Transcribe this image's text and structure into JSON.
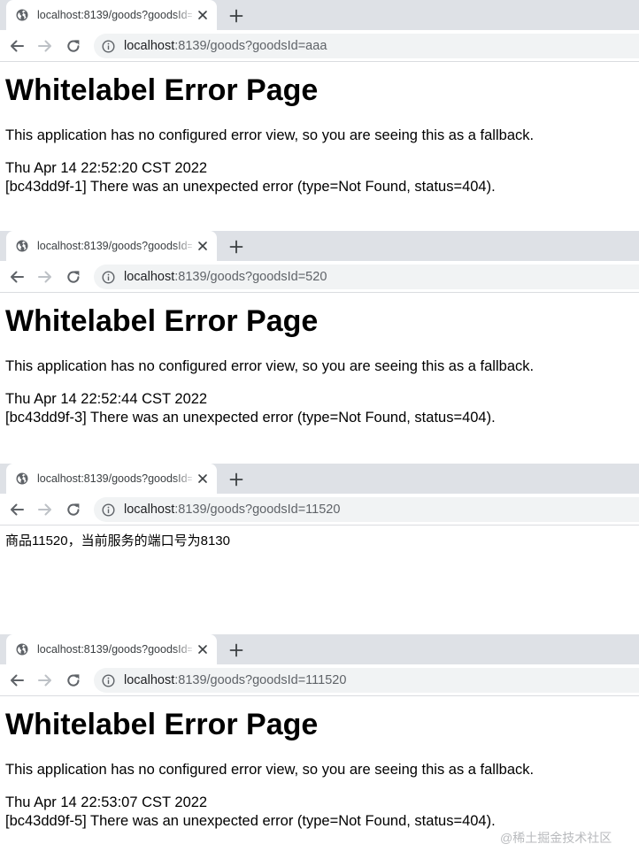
{
  "windows": [
    {
      "tab_title": "localhost:8139/goods?goodsId=aaa",
      "url_host": "localhost",
      "url_rest": ":8139/goods?goodsId=aaa",
      "heading": "Whitelabel Error Page",
      "message": "This application has no configured error view, so you are seeing this as a fallback.",
      "timestamp": "Thu Apr 14 22:52:20 CST 2022",
      "error_detail": "[bc43dd9f-1] There was an unexpected error (type=Not Found, status=404)."
    },
    {
      "tab_title": "localhost:8139/goods?goodsId=520",
      "url_host": "localhost",
      "url_rest": ":8139/goods?goodsId=520",
      "heading": "Whitelabel Error Page",
      "message": "This application has no configured error view, so you are seeing this as a fallback.",
      "timestamp": "Thu Apr 14 22:52:44 CST 2022",
      "error_detail": "[bc43dd9f-3] There was an unexpected error (type=Not Found, status=404)."
    },
    {
      "tab_title": "localhost:8139/goods?goodsId=11520",
      "url_host": "localhost",
      "url_rest": ":8139/goods?goodsId=11520",
      "body_text": "商品11520，当前服务的端口号为8130"
    },
    {
      "tab_title": "localhost:8139/goods?goodsId=111520",
      "url_host": "localhost",
      "url_rest": ":8139/goods?goodsId=111520",
      "heading": "Whitelabel Error Page",
      "message": "This application has no configured error view, so you are seeing this as a fallback.",
      "timestamp": "Thu Apr 14 22:53:07 CST 2022",
      "error_detail": "[bc43dd9f-5] There was an unexpected error (type=Not Found, status=404)."
    }
  ],
  "watermark": "@稀土掘金技术社区",
  "icons": {
    "favicon": "globe-icon",
    "close": "close-icon",
    "new_tab": "plus-icon",
    "back": "arrow-left-icon",
    "forward": "arrow-right-icon",
    "reload": "reload-icon",
    "site_info": "info-icon"
  },
  "colors": {
    "tab_strip": "#dee1e6",
    "omnibox": "#f1f3f4",
    "url_host": "#202124",
    "url_rest": "#5f6368",
    "icon": "#5f6368",
    "icon_disabled": "#bdc1c6",
    "watermark": "#b8babd"
  }
}
